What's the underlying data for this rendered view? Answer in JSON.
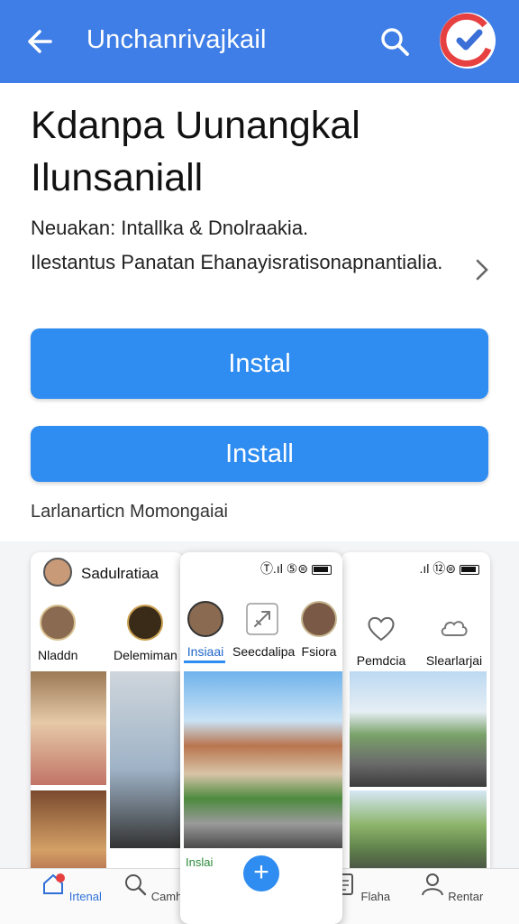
{
  "header": {
    "back_icon": "arrow-left-icon",
    "title": "Unchanrivajkail",
    "search_icon": "search-icon",
    "app_logo_icon": "app-logo-icon"
  },
  "app": {
    "headline": "Kdanpa Uunangkal Ilunsaniall",
    "subtitle_line1": "Neuakan: Intallka & Dnolraakia.",
    "subtitle_line2": "Ilestantus Panatan Ehanayisratisonapnantialia.",
    "more_icon": "chevron-right-icon"
  },
  "buttons": {
    "primary_label": "Instal",
    "secondary_label": "Install"
  },
  "screenshots": {
    "section_title": "Larlanarticn Momongaiai",
    "phone1": {
      "profile_name": "Sadulratiaa",
      "stories": [
        "Nladdn",
        "Delemiman"
      ]
    },
    "phone2": {
      "status": "Ⓣ.ıl ⑤⊜",
      "stories": [
        "Insiaai",
        "Seecdalipa",
        "Fsiora"
      ],
      "bottom_label": "Inslai"
    },
    "phone3": {
      "status": ".ıl ⑫⊜",
      "stories": [
        "Pemdcia",
        "Slearlarjai"
      ]
    }
  },
  "bottom_nav": {
    "items": [
      {
        "label": "Irtenal",
        "icon": "home-icon"
      },
      {
        "label": "Camhar",
        "icon": "search-icon"
      },
      {
        "label": "Flaha",
        "icon": "document-icon"
      },
      {
        "label": "Rentar",
        "icon": "profile-icon"
      }
    ],
    "fab_label": "+"
  },
  "colors": {
    "topbar": "#3f7ee6",
    "button": "#2f8cf0",
    "accent_green": "#2a8a3a"
  }
}
